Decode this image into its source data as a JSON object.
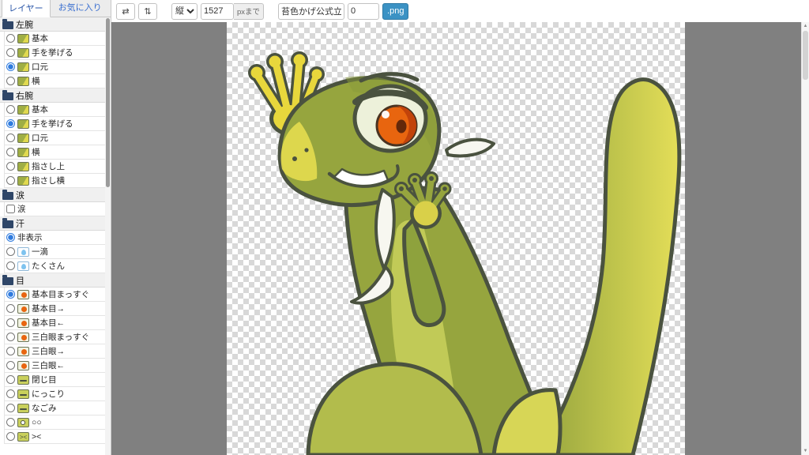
{
  "colors": {
    "accent_blue": "#3b92c4",
    "canvas_background": "#808080",
    "outline_green": "#4a523f",
    "body_green": "#96a53e",
    "highlight_yellow": "#e2da4d",
    "iris_orange": "#e8650f"
  },
  "sidebar": {
    "tabs": [
      {
        "label": "レイヤー",
        "active": true
      },
      {
        "label": "お気に入り",
        "active": false
      }
    ],
    "groups": [
      {
        "label": "左腕",
        "items": [
          {
            "label": "基本",
            "type": "radio",
            "checked": false,
            "thumb": "arm"
          },
          {
            "label": "手を挙げる",
            "type": "radio",
            "checked": false,
            "thumb": "arm"
          },
          {
            "label": "口元",
            "type": "radio",
            "checked": true,
            "thumb": "arm"
          },
          {
            "label": "横",
            "type": "radio",
            "checked": false,
            "thumb": "arm"
          }
        ]
      },
      {
        "label": "右腕",
        "items": [
          {
            "label": "基本",
            "type": "radio",
            "checked": false,
            "thumb": "arm"
          },
          {
            "label": "手を挙げる",
            "type": "radio",
            "checked": true,
            "thumb": "arm"
          },
          {
            "label": "口元",
            "type": "radio",
            "checked": false,
            "thumb": "arm"
          },
          {
            "label": "横",
            "type": "radio",
            "checked": false,
            "thumb": "arm"
          },
          {
            "label": "指さし上",
            "type": "radio",
            "checked": false,
            "thumb": "arm"
          },
          {
            "label": "指さし横",
            "type": "radio",
            "checked": false,
            "thumb": "arm"
          }
        ]
      },
      {
        "label": "涙",
        "items": [
          {
            "label": "涙",
            "type": "checkbox",
            "checked": false,
            "thumb": "none"
          }
        ]
      },
      {
        "label": "汗",
        "items": [
          {
            "label": "非表示",
            "type": "radio",
            "checked": true,
            "thumb": "none"
          },
          {
            "label": "一滴",
            "type": "radio",
            "checked": false,
            "thumb": "drop"
          },
          {
            "label": "たくさん",
            "type": "radio",
            "checked": false,
            "thumb": "drop"
          }
        ]
      },
      {
        "label": "目",
        "items": [
          {
            "label": "基本目まっすぐ",
            "type": "radio",
            "checked": true,
            "thumb": "eye"
          },
          {
            "label": "基本目→",
            "type": "radio",
            "checked": false,
            "thumb": "eye"
          },
          {
            "label": "基本目←",
            "type": "radio",
            "checked": false,
            "thumb": "eye"
          },
          {
            "label": "三白眼まっすぐ",
            "type": "radio",
            "checked": false,
            "thumb": "eye"
          },
          {
            "label": "三白眼→",
            "type": "radio",
            "checked": false,
            "thumb": "eye"
          },
          {
            "label": "三白眼←",
            "type": "radio",
            "checked": false,
            "thumb": "eye"
          },
          {
            "label": "閉じ目",
            "type": "radio",
            "checked": false,
            "thumb": "eye-closed"
          },
          {
            "label": "にっこり",
            "type": "radio",
            "checked": false,
            "thumb": "eye-closed"
          },
          {
            "label": "なごみ",
            "type": "radio",
            "checked": false,
            "thumb": "eye-closed"
          },
          {
            "label": "○○",
            "type": "radio",
            "checked": false,
            "thumb": "eye-round"
          },
          {
            "label": "><",
            "type": "radio",
            "checked": false,
            "thumb": "eye-x"
          }
        ]
      }
    ]
  },
  "toolbar": {
    "flip_horizontal": "⇄",
    "flip_vertical": "⇅",
    "orientation_value": "縦",
    "size_value": "1527",
    "size_unit": "pxまで",
    "filename_value": "苔色かげ公式立ち絵",
    "padding_value": "0",
    "export_label": ".png"
  },
  "canvas": {
    "illustration_subject": "green lizard mascot, standing pose, hand at mouth, hand raised"
  }
}
